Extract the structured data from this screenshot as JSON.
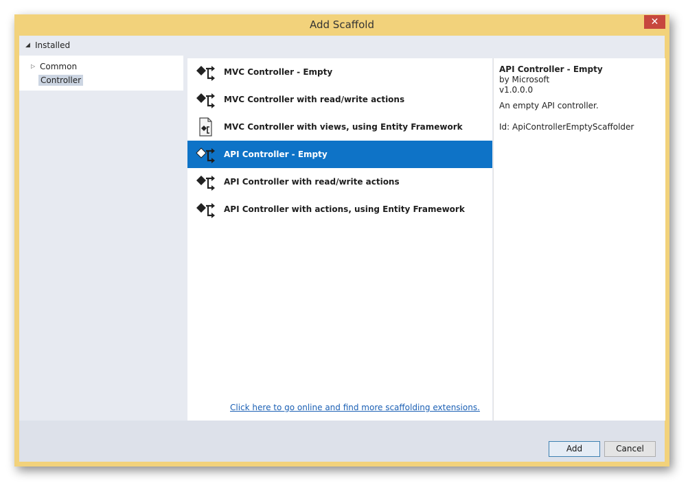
{
  "window": {
    "title": "Add Scaffold",
    "close_glyph": "✕"
  },
  "installed": {
    "label": "Installed",
    "tree": [
      {
        "label": "Common",
        "expanded": false
      },
      {
        "label": "Controller",
        "selected": true
      }
    ]
  },
  "scaffolds": [
    {
      "label": "MVC Controller - Empty",
      "icon": "controller-icon",
      "selected": false
    },
    {
      "label": "MVC Controller with read/write actions",
      "icon": "controller-icon",
      "selected": false
    },
    {
      "label": "MVC Controller with views, using Entity Framework",
      "icon": "document-controller-icon",
      "selected": false
    },
    {
      "label": "API Controller - Empty",
      "icon": "controller-icon",
      "selected": true
    },
    {
      "label": "API Controller with read/write actions",
      "icon": "controller-icon",
      "selected": false
    },
    {
      "label": "API Controller with actions, using Entity Framework",
      "icon": "controller-icon",
      "selected": false
    }
  ],
  "online_link": "Click here to go online and find more scaffolding extensions.",
  "details": {
    "title": "API Controller - Empty",
    "author": "by Microsoft",
    "version": "v1.0.0.0",
    "description": "An empty API controller.",
    "id": "Id: ApiControllerEmptyScaffolder"
  },
  "buttons": {
    "add": "Add",
    "cancel": "Cancel"
  },
  "colors": {
    "frame": "#f2d27b",
    "selection": "#0e73c7",
    "close": "#c7483e",
    "link": "#1a5fb4"
  }
}
